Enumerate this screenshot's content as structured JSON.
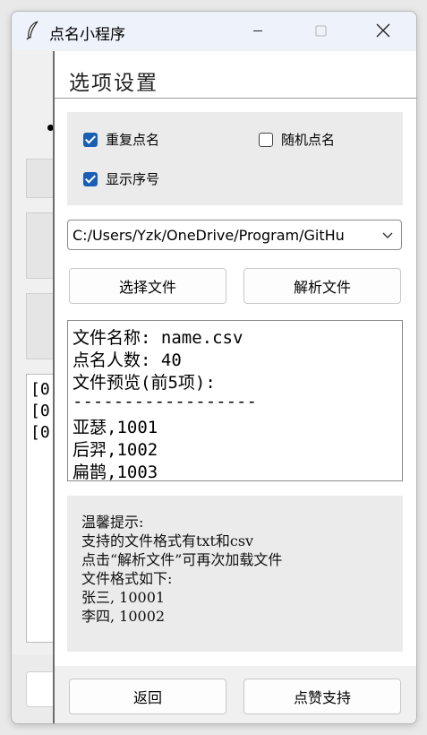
{
  "window": {
    "title": "点名小程序",
    "icon": "feather-quill-icon",
    "controls": [
      "minimize-icon",
      "maximize-icon",
      "close-icon"
    ]
  },
  "background": {
    "log_lines": [
      "[0",
      "[0",
      "[0"
    ]
  },
  "dialog": {
    "title": "选项设置",
    "options": {
      "repeat_call": {
        "label": "重复点名",
        "checked": true
      },
      "random_call": {
        "label": "随机点名",
        "checked": false
      },
      "show_index": {
        "label": "显示序号",
        "checked": true
      }
    },
    "file_path": {
      "value": "C:/Users/Yzk/OneDrive/Program/GitHu"
    },
    "buttons": {
      "select_file": "选择文件",
      "parse_file": "解析文件",
      "back": "返回",
      "like": "点赞支持"
    },
    "preview": {
      "lines": [
        "文件名称: name.csv",
        "点名人数: 40",
        "文件预览(前5项):",
        "------------------",
        "亚瑟,1001",
        "后羿,1002",
        "扁鹊,1003"
      ]
    },
    "tips": {
      "lines": [
        "温馨提示:",
        "支持的文件格式有txt和csv",
        "点击“解析文件”可再次加载文件",
        "文件格式如下:",
        "张三, 10001",
        "李四, 10002"
      ]
    }
  },
  "colors": {
    "checkbox_checked": "#1a5fb4",
    "titlebar": "#eef2fa",
    "panel": "#ebebeb"
  }
}
